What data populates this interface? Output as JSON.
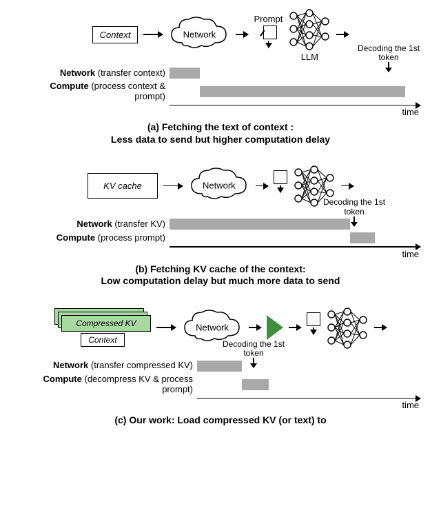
{
  "common": {
    "network_label": "Network",
    "prompt_label": "Prompt",
    "llm_label": "LLM",
    "time_label": "time",
    "decoding_label": "Decoding the 1st token"
  },
  "panel_a": {
    "context_box": "Context",
    "network_row_label": "Network",
    "network_row_desc": "(transfer context)",
    "compute_row_label": "Compute",
    "compute_row_desc": "(process context & prompt)",
    "caption": "(a) Fetching the text of context :\nLess data to send but higher computation delay"
  },
  "panel_b": {
    "kv_box": "KV cache",
    "network_row_label": "Network",
    "network_row_desc": "(transfer KV)",
    "compute_row_label": "Compute",
    "compute_row_desc": "(process prompt)",
    "caption": "(b) Fetching KV cache of the context:\nLow computation delay but much more data to send"
  },
  "panel_c": {
    "comp_kv_label": "Compressed KV",
    "context_box": "Context",
    "network_row_label": "Network",
    "network_row_desc": "(transfer compressed KV)",
    "compute_row_label": "Compute",
    "compute_row_desc": "(decompress KV & process prompt)",
    "caption": "(c) Our work: Load compressed KV (or text) to"
  },
  "chart_data": [
    {
      "panel": "a",
      "type": "bar",
      "title": "Timeline (panel a)",
      "xlabel": "time",
      "ylabel": "",
      "categories": [
        "Network (transfer context)",
        "Compute (process context & prompt)"
      ],
      "series": [
        {
          "name": "start_pct",
          "values": [
            0,
            12
          ]
        },
        {
          "name": "duration_pct",
          "values": [
            12,
            82
          ]
        }
      ],
      "decoding_marker_pct": 94
    },
    {
      "panel": "b",
      "type": "bar",
      "title": "Timeline (panel b)",
      "xlabel": "time",
      "ylabel": "",
      "categories": [
        "Network (transfer KV)",
        "Compute (process prompt)"
      ],
      "series": [
        {
          "name": "start_pct",
          "values": [
            0,
            72
          ]
        },
        {
          "name": "duration_pct",
          "values": [
            72,
            10
          ]
        }
      ],
      "decoding_marker_pct": 82
    },
    {
      "panel": "c",
      "type": "bar",
      "title": "Timeline (panel c)",
      "xlabel": "time",
      "ylabel": "",
      "categories": [
        "Network (transfer compressed KV)",
        "Compute (decompress KV & process prompt)"
      ],
      "series": [
        {
          "name": "start_pct",
          "values": [
            0,
            20
          ]
        },
        {
          "name": "duration_pct",
          "values": [
            20,
            12
          ]
        }
      ],
      "decoding_marker_pct": 32
    }
  ]
}
